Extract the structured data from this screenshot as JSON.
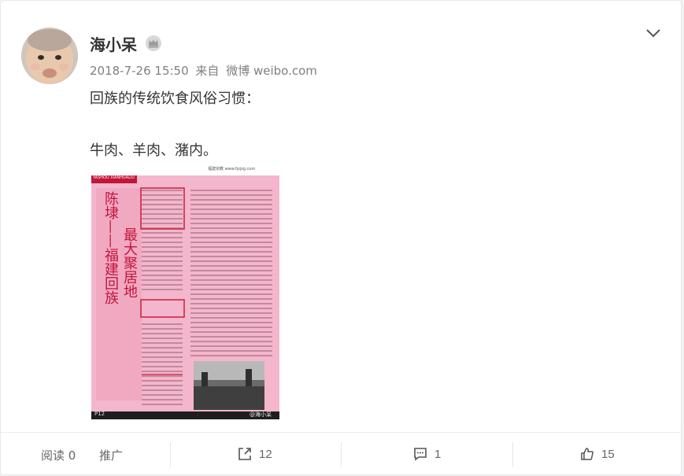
{
  "post": {
    "username": "海小呆",
    "timestamp": "2018-7-26 15:50",
    "source_prefix": "来自",
    "source": "微博 weibo.com",
    "text_line1": "回族的传统饮食风俗习惯：",
    "text_line2": "牛肉、羊肉、潴内。",
    "image": {
      "page_header": "福建宗教 www.fjzjzg.com",
      "tag": "YASHOU XIANHUALIU",
      "title_main": "陈埭——福建回族",
      "title_sub": "最大聚居地",
      "page_number": "P12",
      "watermark": "@海小呆"
    }
  },
  "footer": {
    "read_label": "阅读",
    "read_count": "0",
    "promote_label": "推广",
    "repost_count": "12",
    "comment_count": "1",
    "like_count": "15"
  },
  "colors": {
    "page_pink": "#f4b6cc",
    "title_red": "#d01c36",
    "text": "#333333",
    "muted": "#808080"
  }
}
